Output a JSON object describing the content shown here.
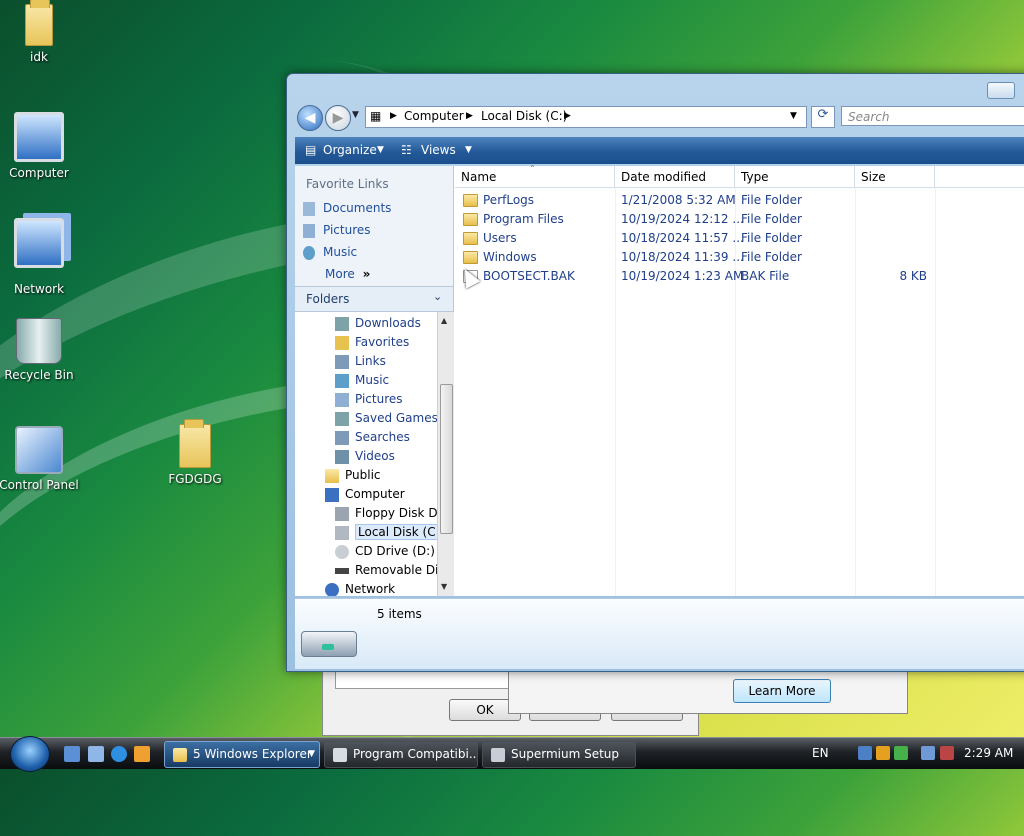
{
  "desktop": {
    "icons": [
      {
        "label": "idk",
        "icon": "folder-icon"
      },
      {
        "label": "Computer",
        "icon": "computer-icon"
      },
      {
        "label": "Network",
        "icon": "network-icon"
      },
      {
        "label": "Recycle Bin",
        "icon": "recycle-bin-icon"
      },
      {
        "label": "Control Panel",
        "icon": "control-panel-icon"
      },
      {
        "label": "FGDGDG",
        "icon": "folder-icon"
      }
    ]
  },
  "background_dialog": {
    "ok_label": "OK",
    "learn_more_label": "Learn More"
  },
  "explorer": {
    "address": {
      "segments": [
        "Computer",
        "Local Disk (C:)"
      ]
    },
    "search_placeholder": "Search",
    "toolbar": {
      "organize": "Organize",
      "views": "Views"
    },
    "favorite_links": {
      "title": "Favorite Links",
      "items": [
        "Documents",
        "Pictures",
        "Music"
      ],
      "more": "More"
    },
    "folders_label": "Folders",
    "tree": [
      "Downloads",
      "Favorites",
      "Links",
      "Music",
      "Pictures",
      "Saved Games",
      "Searches",
      "Videos",
      "Public",
      "Computer",
      "Floppy Disk Dr",
      "Local Disk (C:)",
      "CD Drive (D:)",
      "Removable Dis",
      "Network"
    ],
    "columns": [
      "Name",
      "Date modified",
      "Type",
      "Size"
    ],
    "files": [
      {
        "name": "PerfLogs",
        "date": "1/21/2008 5:32 AM",
        "type": "File Folder",
        "size": ""
      },
      {
        "name": "Program Files",
        "date": "10/19/2024 12:12 ...",
        "type": "File Folder",
        "size": ""
      },
      {
        "name": "Users",
        "date": "10/18/2024 11:57 ...",
        "type": "File Folder",
        "size": ""
      },
      {
        "name": "Windows",
        "date": "10/18/2024 11:39 ...",
        "type": "File Folder",
        "size": ""
      },
      {
        "name": "BOOTSECT.BAK",
        "date": "10/19/2024 1:23 AM",
        "type": "BAK File",
        "size": "8 KB"
      }
    ],
    "status": "5 items"
  },
  "taskbar": {
    "buttons": [
      "5 Windows Explorer",
      "Program Compatibi...",
      "Supermium Setup"
    ],
    "language": "EN",
    "clock": "2:29 AM"
  }
}
